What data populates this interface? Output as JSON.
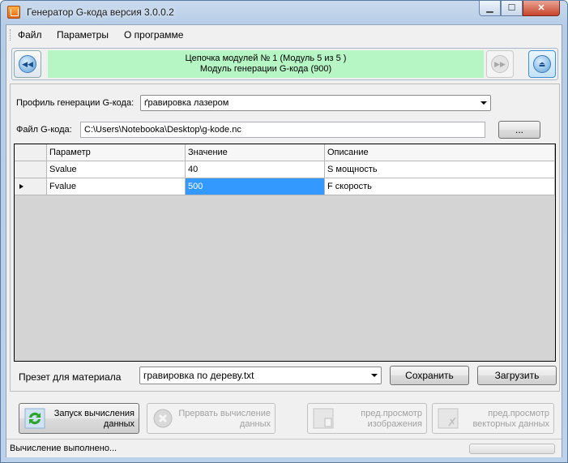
{
  "window": {
    "title": "Генератор G-кода версия 3.0.0.2",
    "controls": {
      "minimize": "▁",
      "maximize": "☐",
      "close": "✕"
    }
  },
  "menu": [
    "Файл",
    "Параметры",
    "О программе"
  ],
  "module_bar": {
    "line1": "Цепочка модулей № 1 (Модуль 5 из 5 )",
    "line2": "Модуль генерации G-кода (900)",
    "prev_icon": "rewind-icon",
    "next_icon": "fast-forward-icon",
    "eject_icon": "eject-icon",
    "prev_glyph": "◀◀",
    "next_glyph": "▶▶",
    "eject_glyph": "⏏"
  },
  "profile": {
    "label": "Профиль генерации G-кода:",
    "value": "ґравировка лазером"
  },
  "file": {
    "label": "Файл G-кода:",
    "value": "C:\\Users\\Notebooka\\Desktop\\g-kode.nc",
    "browse_label": "..."
  },
  "grid": {
    "columns": [
      "Параметр",
      "Значение",
      "Описание"
    ],
    "rows": [
      {
        "param": "Svalue",
        "value": "40",
        "desc": "S мощность"
      },
      {
        "param": "Fvalue",
        "value": "500",
        "desc": "F скорость"
      }
    ],
    "current_row": 1
  },
  "preset": {
    "label": "Презет для материала",
    "value": "гравировка по дереву.txt",
    "save_label": "Сохранить",
    "load_label": "Загрузить"
  },
  "actions": {
    "run": {
      "line1": "Запуск вычисления",
      "line2": "данных"
    },
    "abort": {
      "line1": "Прервать вычисление",
      "line2": "данных"
    },
    "preview_image": {
      "line1": "пред.просмотр",
      "line2": "изображения"
    },
    "preview_vector": {
      "line1": "пред.просмотр",
      "line2": "векторных данных"
    }
  },
  "status": {
    "text": "Вычисление выполнено...",
    "progress": 0
  },
  "colors": {
    "module_info_bg": "#b6f5c4",
    "selection": "#3399ff",
    "grid_empty": "#d4d4d4"
  }
}
